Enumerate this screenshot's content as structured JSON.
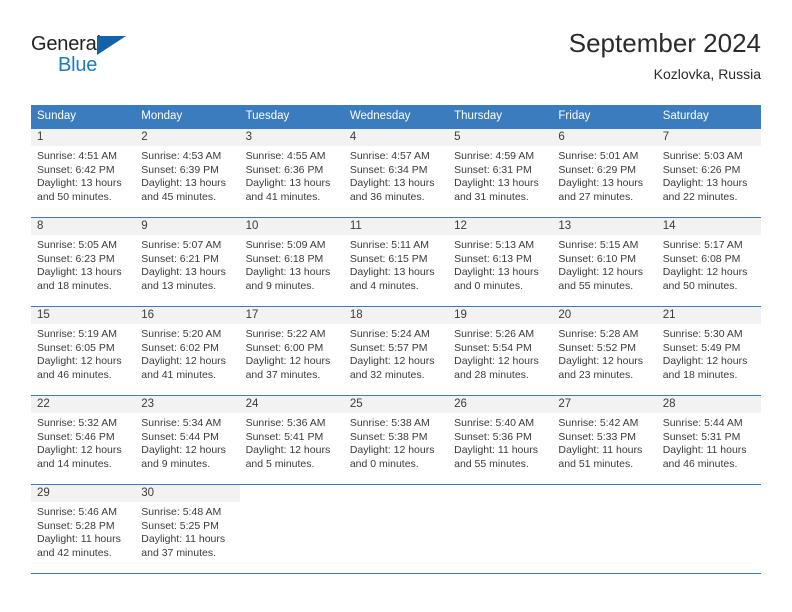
{
  "brand": {
    "name_top": "General",
    "name_bottom": "Blue",
    "accent_color": "#1463a8",
    "text_color": "#231f20"
  },
  "header": {
    "month_title": "September 2024",
    "location": "Kozlovka, Russia"
  },
  "theme": {
    "header_bg": "#3a7cbe",
    "header_text": "#ffffff",
    "daynum_bg": "#f2f2f2",
    "rule_color": "#3a7cbe",
    "body_text": "#3b3b3b"
  },
  "calendar": {
    "weekday_headers": [
      "Sunday",
      "Monday",
      "Tuesday",
      "Wednesday",
      "Thursday",
      "Friday",
      "Saturday"
    ],
    "weeks": [
      [
        {
          "day": "1",
          "lines": [
            "Sunrise: 4:51 AM",
            "Sunset: 6:42 PM",
            "Daylight: 13 hours",
            "and 50 minutes."
          ]
        },
        {
          "day": "2",
          "lines": [
            "Sunrise: 4:53 AM",
            "Sunset: 6:39 PM",
            "Daylight: 13 hours",
            "and 45 minutes."
          ]
        },
        {
          "day": "3",
          "lines": [
            "Sunrise: 4:55 AM",
            "Sunset: 6:36 PM",
            "Daylight: 13 hours",
            "and 41 minutes."
          ]
        },
        {
          "day": "4",
          "lines": [
            "Sunrise: 4:57 AM",
            "Sunset: 6:34 PM",
            "Daylight: 13 hours",
            "and 36 minutes."
          ]
        },
        {
          "day": "5",
          "lines": [
            "Sunrise: 4:59 AM",
            "Sunset: 6:31 PM",
            "Daylight: 13 hours",
            "and 31 minutes."
          ]
        },
        {
          "day": "6",
          "lines": [
            "Sunrise: 5:01 AM",
            "Sunset: 6:29 PM",
            "Daylight: 13 hours",
            "and 27 minutes."
          ]
        },
        {
          "day": "7",
          "lines": [
            "Sunrise: 5:03 AM",
            "Sunset: 6:26 PM",
            "Daylight: 13 hours",
            "and 22 minutes."
          ]
        }
      ],
      [
        {
          "day": "8",
          "lines": [
            "Sunrise: 5:05 AM",
            "Sunset: 6:23 PM",
            "Daylight: 13 hours",
            "and 18 minutes."
          ]
        },
        {
          "day": "9",
          "lines": [
            "Sunrise: 5:07 AM",
            "Sunset: 6:21 PM",
            "Daylight: 13 hours",
            "and 13 minutes."
          ]
        },
        {
          "day": "10",
          "lines": [
            "Sunrise: 5:09 AM",
            "Sunset: 6:18 PM",
            "Daylight: 13 hours",
            "and 9 minutes."
          ]
        },
        {
          "day": "11",
          "lines": [
            "Sunrise: 5:11 AM",
            "Sunset: 6:15 PM",
            "Daylight: 13 hours",
            "and 4 minutes."
          ]
        },
        {
          "day": "12",
          "lines": [
            "Sunrise: 5:13 AM",
            "Sunset: 6:13 PM",
            "Daylight: 13 hours",
            "and 0 minutes."
          ]
        },
        {
          "day": "13",
          "lines": [
            "Sunrise: 5:15 AM",
            "Sunset: 6:10 PM",
            "Daylight: 12 hours",
            "and 55 minutes."
          ]
        },
        {
          "day": "14",
          "lines": [
            "Sunrise: 5:17 AM",
            "Sunset: 6:08 PM",
            "Daylight: 12 hours",
            "and 50 minutes."
          ]
        }
      ],
      [
        {
          "day": "15",
          "lines": [
            "Sunrise: 5:19 AM",
            "Sunset: 6:05 PM",
            "Daylight: 12 hours",
            "and 46 minutes."
          ]
        },
        {
          "day": "16",
          "lines": [
            "Sunrise: 5:20 AM",
            "Sunset: 6:02 PM",
            "Daylight: 12 hours",
            "and 41 minutes."
          ]
        },
        {
          "day": "17",
          "lines": [
            "Sunrise: 5:22 AM",
            "Sunset: 6:00 PM",
            "Daylight: 12 hours",
            "and 37 minutes."
          ]
        },
        {
          "day": "18",
          "lines": [
            "Sunrise: 5:24 AM",
            "Sunset: 5:57 PM",
            "Daylight: 12 hours",
            "and 32 minutes."
          ]
        },
        {
          "day": "19",
          "lines": [
            "Sunrise: 5:26 AM",
            "Sunset: 5:54 PM",
            "Daylight: 12 hours",
            "and 28 minutes."
          ]
        },
        {
          "day": "20",
          "lines": [
            "Sunrise: 5:28 AM",
            "Sunset: 5:52 PM",
            "Daylight: 12 hours",
            "and 23 minutes."
          ]
        },
        {
          "day": "21",
          "lines": [
            "Sunrise: 5:30 AM",
            "Sunset: 5:49 PM",
            "Daylight: 12 hours",
            "and 18 minutes."
          ]
        }
      ],
      [
        {
          "day": "22",
          "lines": [
            "Sunrise: 5:32 AM",
            "Sunset: 5:46 PM",
            "Daylight: 12 hours",
            "and 14 minutes."
          ]
        },
        {
          "day": "23",
          "lines": [
            "Sunrise: 5:34 AM",
            "Sunset: 5:44 PM",
            "Daylight: 12 hours",
            "and 9 minutes."
          ]
        },
        {
          "day": "24",
          "lines": [
            "Sunrise: 5:36 AM",
            "Sunset: 5:41 PM",
            "Daylight: 12 hours",
            "and 5 minutes."
          ]
        },
        {
          "day": "25",
          "lines": [
            "Sunrise: 5:38 AM",
            "Sunset: 5:38 PM",
            "Daylight: 12 hours",
            "and 0 minutes."
          ]
        },
        {
          "day": "26",
          "lines": [
            "Sunrise: 5:40 AM",
            "Sunset: 5:36 PM",
            "Daylight: 11 hours",
            "and 55 minutes."
          ]
        },
        {
          "day": "27",
          "lines": [
            "Sunrise: 5:42 AM",
            "Sunset: 5:33 PM",
            "Daylight: 11 hours",
            "and 51 minutes."
          ]
        },
        {
          "day": "28",
          "lines": [
            "Sunrise: 5:44 AM",
            "Sunset: 5:31 PM",
            "Daylight: 11 hours",
            "and 46 minutes."
          ]
        }
      ],
      [
        {
          "day": "29",
          "lines": [
            "Sunrise: 5:46 AM",
            "Sunset: 5:28 PM",
            "Daylight: 11 hours",
            "and 42 minutes."
          ]
        },
        {
          "day": "30",
          "lines": [
            "Sunrise: 5:48 AM",
            "Sunset: 5:25 PM",
            "Daylight: 11 hours",
            "and 37 minutes."
          ]
        },
        {
          "day": "",
          "lines": []
        },
        {
          "day": "",
          "lines": []
        },
        {
          "day": "",
          "lines": []
        },
        {
          "day": "",
          "lines": []
        },
        {
          "day": "",
          "lines": []
        }
      ]
    ]
  }
}
